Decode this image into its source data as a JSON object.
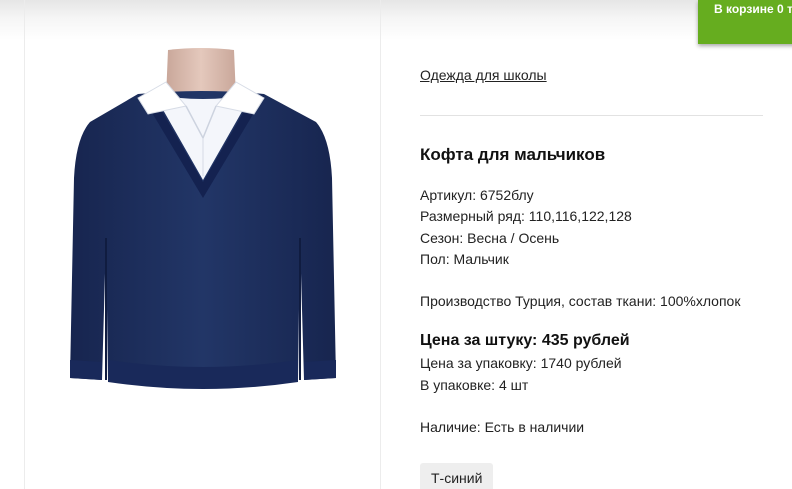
{
  "cart": {
    "label": "В корзине 0 т"
  },
  "breadcrumb": "Одежда для школы",
  "product": {
    "title": "Кофта для мальчиков",
    "article": "Артикул: 6752блу",
    "size_range": "Размерный ряд: 110,116,122,128",
    "season": "Сезон: Весна / Осень",
    "gender": "Пол: Мальчик",
    "production": "Производство Турция, состав ткани: 100%хлопок",
    "price_per_item": "Цена за штуку: 435 рублей",
    "price_per_pack": "Цена за упаковку: 1740 рублей",
    "pack_size": "В упаковке: 4 шт",
    "availability": "Наличие: Есть в наличии",
    "color_option": "Т-синий",
    "image_icon": "sweater-image"
  },
  "colors": {
    "cart_green": "#66ad1f",
    "sweater_navy": "#1c2d5e"
  }
}
